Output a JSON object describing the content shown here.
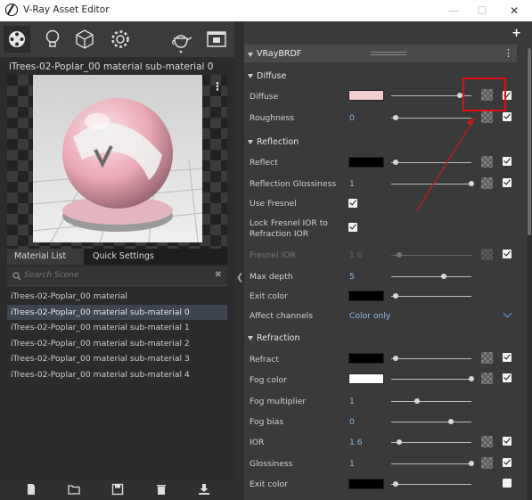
{
  "window": {
    "title": "V-Ray Asset Editor",
    "controls": [
      "—",
      "☐",
      "✕"
    ]
  },
  "toolbar": {
    "icons": [
      "materials-icon",
      "lights-icon",
      "geometry-icon",
      "settings-icon",
      "render-teapot-icon",
      "render-frame-icon"
    ]
  },
  "preview": {
    "material_name": "iTrees-02-Poplar_00 material sub-material 0",
    "menu_glyph": "⋮"
  },
  "tabs": {
    "material_list": "Material List",
    "quick_settings": "Quick Settings"
  },
  "search": {
    "placeholder": "Search Scene",
    "clear_glyph": "✖"
  },
  "materials": [
    "iTrees-02-Poplar_00 material",
    "iTrees-02-Poplar_00 material sub-material 0",
    "iTrees-02-Poplar_00 material sub-material 1",
    "iTrees-02-Poplar_00 material sub-material 2",
    "iTrees-02-Poplar_00 material sub-material 3",
    "iTrees-02-Poplar_00 material sub-material 4"
  ],
  "selected_material_index": 1,
  "bottom_icons": [
    "new-file-icon",
    "open-folder-icon",
    "save-icon",
    "delete-icon",
    "import-icon"
  ],
  "editor": {
    "add_glyph": "+",
    "layer_title": "VRayBRDF",
    "menu_glyph": "⋮",
    "diffuse": {
      "title": "Diffuse",
      "diffuse_label": "Diffuse",
      "diffuse_color": "#f3cdd3",
      "diffuse_slider": 0.86,
      "diffuse_checked": true,
      "roughness_label": "Roughness",
      "roughness_value": "0",
      "roughness_slider": 0.05,
      "roughness_checked": true
    },
    "reflection": {
      "title": "Reflection",
      "reflect_label": "Reflect",
      "reflect_color": "#000000",
      "reflect_slider": 0.05,
      "reflect_checked": true,
      "gloss_label": "Reflection Glossiness",
      "gloss_value": "1",
      "gloss_slider": 1.0,
      "gloss_checked": true,
      "fresnel_label": "Use Fresnel",
      "fresnel_checked": true,
      "lock_label_1": "Lock Fresnel IOR to",
      "lock_label_2": "Refraction IOR",
      "lock_checked": true,
      "fresnel_ior_label": "Fresnel IOR",
      "fresnel_ior_value": "1.6",
      "fresnel_ior_slider": 0.1,
      "fresnel_ior_checked": true,
      "max_depth_label": "Max depth",
      "max_depth_value": "5",
      "max_depth_slider": 0.65,
      "exit_color_label": "Exit color",
      "exit_color": "#000000",
      "exit_slider": 0.05,
      "affect_label": "Affect channels",
      "affect_value": "Color only"
    },
    "refraction": {
      "title": "Refraction",
      "refract_label": "Refract",
      "refract_color": "#000000",
      "refract_slider": 0.05,
      "refract_checked": true,
      "fog_color_label": "Fog color",
      "fog_color": "#ffffff",
      "fog_color_slider": 1.0,
      "fog_color_checked": true,
      "fog_mult_label": "Fog multiplier",
      "fog_mult_value": "1",
      "fog_mult_slider": 0.32,
      "fog_bias_label": "Fog bias",
      "fog_bias_value": "0",
      "fog_bias_slider": 0.74,
      "ior_label": "IOR",
      "ior_value": "1.6",
      "ior_slider": 0.1,
      "ior_checked": true,
      "gloss_label": "Glossiness",
      "gloss_value": "1",
      "gloss_slider": 1.0,
      "gloss_checked": true,
      "exit_label": "Exit color",
      "exit_color": "#000000",
      "exit_slider": 0.05,
      "exit_checked": false
    }
  },
  "annotation": {
    "box_color": "#e01010",
    "arrow_color": "#c81a1a"
  }
}
